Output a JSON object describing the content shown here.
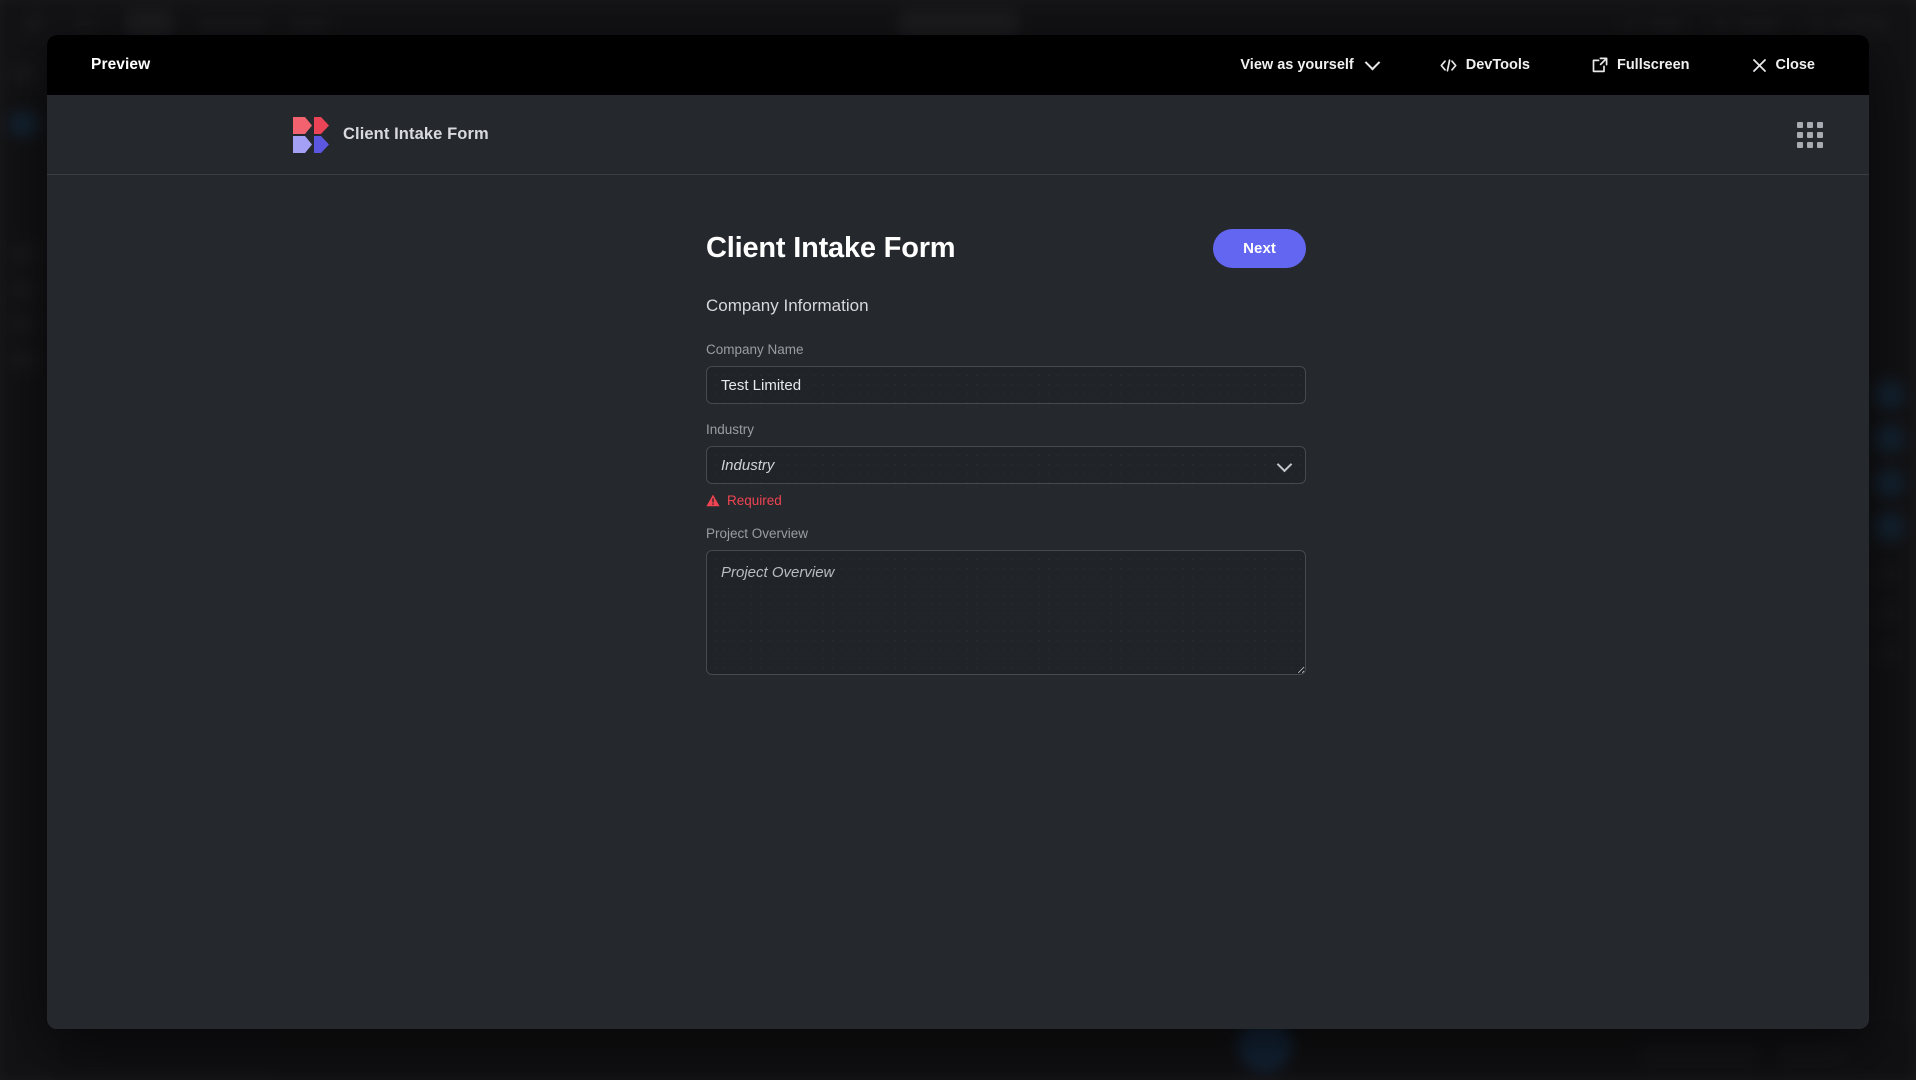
{
  "preview_bar": {
    "title": "Preview",
    "actions": [
      {
        "label": "View as yourself",
        "icon": "chevron-down-icon"
      },
      {
        "label": "DevTools",
        "icon": "code-brackets-icon"
      },
      {
        "label": "Fullscreen",
        "icon": "external-link-icon"
      },
      {
        "label": "Close",
        "icon": "close-x-icon"
      }
    ]
  },
  "app_header": {
    "brand_name": "Client Intake Form",
    "logo_colors": [
      "#f2626f",
      "#ea4456",
      "#a3a0f5",
      "#5b57e0"
    ],
    "apps_grid_icon": "grid-dots-icon"
  },
  "form": {
    "title": "Client Intake Form",
    "next_label": "Next",
    "section_title": "Company Information",
    "accent_color": "#6366f1",
    "error_color": "#ef4452",
    "fields": [
      {
        "label": "Company Name",
        "type": "text",
        "value": "Test Limited",
        "placeholder": "Company Name",
        "error": ""
      },
      {
        "label": "Industry",
        "type": "select",
        "value": "Industry",
        "placeholder": "Industry",
        "error": "Required",
        "error_icon": "warning-triangle-icon"
      },
      {
        "label": "Project Overview",
        "type": "textarea",
        "value": "",
        "placeholder": "Project Overview",
        "error": ""
      }
    ]
  }
}
